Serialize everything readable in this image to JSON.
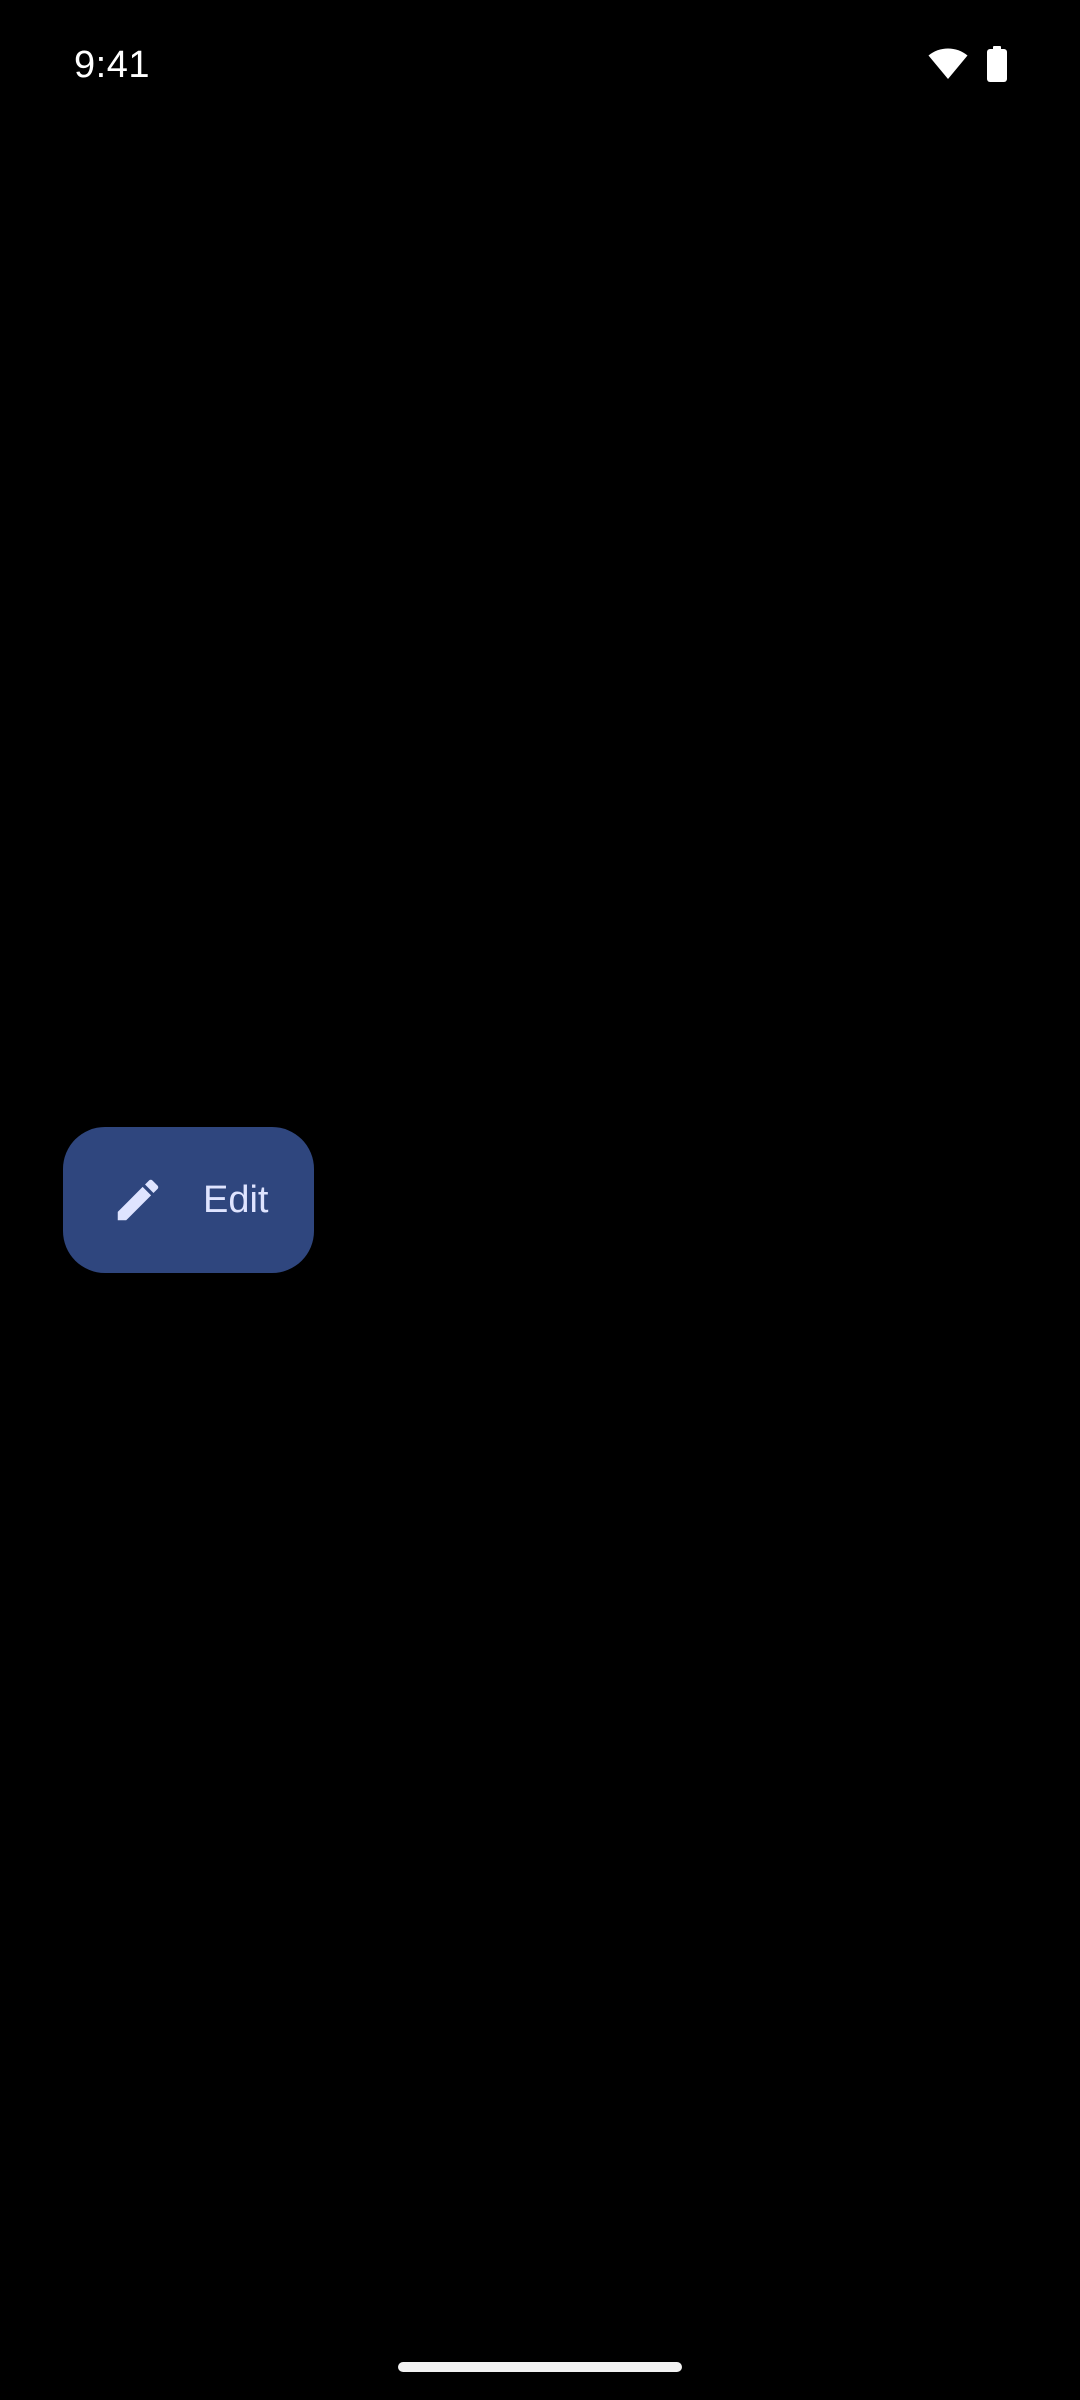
{
  "status_bar": {
    "time": "9:41",
    "icons": [
      "wifi-icon",
      "battery-icon"
    ]
  },
  "fab": {
    "label": "Edit",
    "icon": "pencil-icon"
  },
  "colors": {
    "background": "#000000",
    "fab_background": "#2f467e",
    "fab_content": "#dfe4ff"
  }
}
